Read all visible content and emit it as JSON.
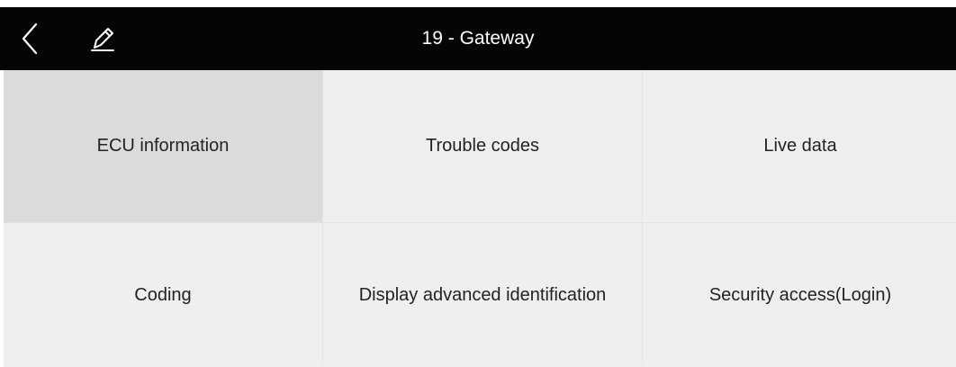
{
  "header": {
    "title": "19 - Gateway",
    "back_icon": "chevron-left-icon",
    "edit_icon": "pencil-icon"
  },
  "menu": {
    "items": [
      {
        "label": "ECU information",
        "selected": true
      },
      {
        "label": "Trouble codes",
        "selected": false
      },
      {
        "label": "Live data",
        "selected": false
      },
      {
        "label": "Coding",
        "selected": false
      },
      {
        "label": "Display advanced identification",
        "selected": false
      },
      {
        "label": "Security access(Login)",
        "selected": false
      }
    ]
  },
  "colors": {
    "header_bg": "#050505",
    "cell_bg": "#efefef",
    "selected_cell_bg": "#dbdbdb",
    "text": "#222222"
  }
}
